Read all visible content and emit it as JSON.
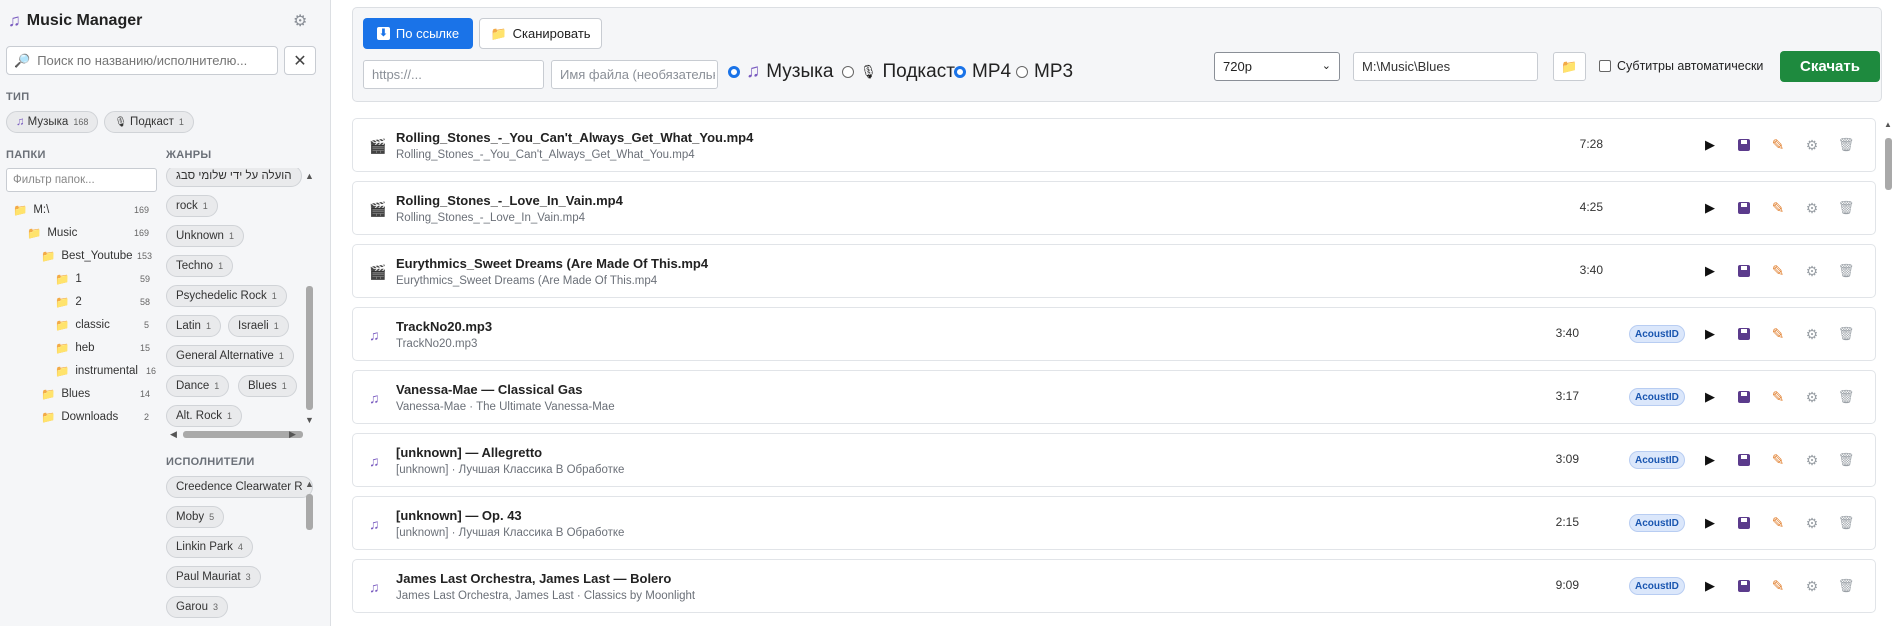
{
  "app": {
    "title": "Music Manager"
  },
  "search": {
    "placeholder": "Поиск по названию/исполнителю...",
    "clear": "✕"
  },
  "sections": {
    "type": "ТИП",
    "folders": "ПАПКИ",
    "genres": "ЖАНРЫ",
    "artists": "ИСПОЛНИТЕЛИ"
  },
  "type_pills": [
    {
      "label": "Музыка",
      "count": "168"
    },
    {
      "label": "Подкаст",
      "count": "1"
    }
  ],
  "folders": {
    "filter_placeholder": "Фильтр папок...",
    "items": [
      {
        "label": "M:\\",
        "count": "169"
      },
      {
        "label": "Music",
        "count": "169"
      },
      {
        "label": "Best_Youtube",
        "count": "153"
      },
      {
        "label": "1",
        "count": "59"
      },
      {
        "label": "2",
        "count": "58"
      },
      {
        "label": "classic",
        "count": "5"
      },
      {
        "label": "heb",
        "count": "15"
      },
      {
        "label": "instrumental",
        "count": "16"
      },
      {
        "label": "Blues",
        "count": "14"
      },
      {
        "label": "Downloads",
        "count": "2"
      }
    ]
  },
  "genres": [
    {
      "label": "הועלה על ידי שלומי סבג",
      "count": ""
    },
    {
      "label": "rock",
      "count": "1"
    },
    {
      "label": "Unknown",
      "count": "1"
    },
    {
      "label": "Techno",
      "count": "1"
    },
    {
      "label": "Psychedelic Rock",
      "count": "1"
    },
    {
      "label": "Latin",
      "count": "1"
    },
    {
      "label": "Israeli",
      "count": "1"
    },
    {
      "label": "General Alternative",
      "count": "1"
    },
    {
      "label": "Dance",
      "count": "1"
    },
    {
      "label": "Blues",
      "count": "1"
    },
    {
      "label": "Alt. Rock",
      "count": "1"
    }
  ],
  "artists": [
    {
      "label": "Creedence Clearwater R",
      "count": ""
    },
    {
      "label": "Moby",
      "count": "5"
    },
    {
      "label": "Linkin Park",
      "count": "4"
    },
    {
      "label": "Paul Mauriat",
      "count": "3"
    },
    {
      "label": "Garou",
      "count": "3"
    }
  ],
  "toolbar": {
    "by_link": "По ссылке",
    "scan": "Сканировать",
    "url_placeholder": "https://...",
    "filename_placeholder": "Имя файла (необязательно)",
    "kind_music": "Музыка",
    "kind_podcast": "Подкаст",
    "fmt_mp4": "MP4",
    "fmt_mp3": "MP3",
    "quality": "720p",
    "path": "M:\\Music\\Blues",
    "subtitles": "Субтитры автоматически",
    "download": "Скачать"
  },
  "tracks": [
    {
      "type": "video",
      "title": "Rolling_Stones_-_You_Can't_Always_Get_What_You.mp4",
      "sub": "Rolling_Stones_-_You_Can't_Always_Get_What_You.mp4",
      "duration": "7:28",
      "badge": ""
    },
    {
      "type": "video",
      "title": "Rolling_Stones_-_Love_In_Vain.mp4",
      "sub": "Rolling_Stones_-_Love_In_Vain.mp4",
      "duration": "4:25",
      "badge": ""
    },
    {
      "type": "video",
      "title": "Eurythmics_Sweet Dreams (Are Made Of This.mp4",
      "sub": "Eurythmics_Sweet Dreams (Are Made Of This.mp4",
      "duration": "3:40",
      "badge": ""
    },
    {
      "type": "audio",
      "title": "TrackNo20.mp3",
      "sub": "TrackNo20.mp3",
      "duration": "3:40",
      "badge": "AcoustID"
    },
    {
      "type": "audio",
      "title": "Vanessa-Mae — Classical Gas",
      "sub": "Vanessa-Mae · The Ultimate Vanessa-Mae",
      "duration": "3:17",
      "badge": "AcoustID"
    },
    {
      "type": "audio",
      "title": "[unknown] — Allegretto",
      "sub": "[unknown] · Лучшая Классика В Обработке",
      "duration": "3:09",
      "badge": "AcoustID"
    },
    {
      "type": "audio",
      "title": "[unknown] — Op. 43",
      "sub": "[unknown] · Лучшая Классика В Обработке",
      "duration": "2:15",
      "badge": "AcoustID"
    },
    {
      "type": "audio",
      "title": "James Last Orchestra, James Last — Bolero",
      "sub": "James Last Orchestra, James Last · Classics by Moonlight",
      "duration": "9:09",
      "badge": "AcoustID"
    }
  ],
  "colors": {
    "accent": "#1a73e8",
    "download": "#1e8a3e",
    "badge_bg": "#dbe7fb"
  }
}
